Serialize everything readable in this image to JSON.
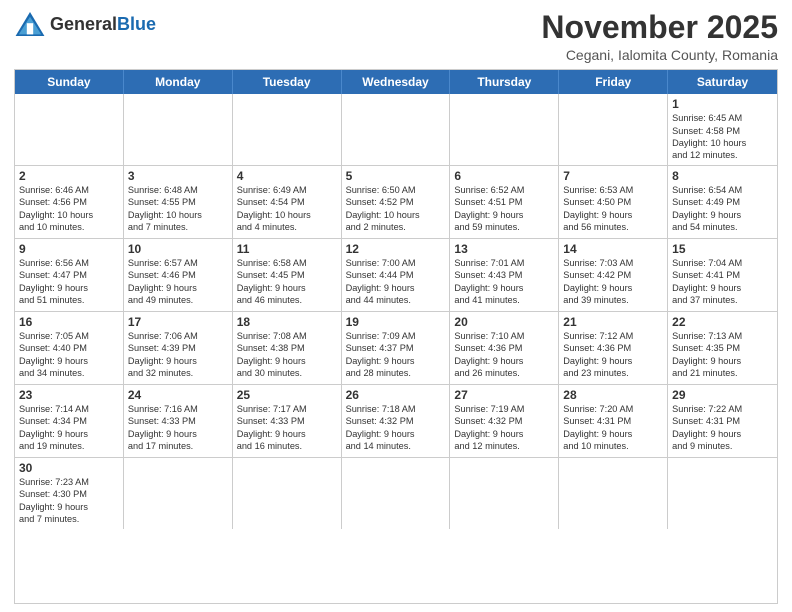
{
  "logo": {
    "text_general": "General",
    "text_blue": "Blue"
  },
  "header": {
    "title": "November 2025",
    "subtitle": "Cegani, Ialomita County, Romania"
  },
  "day_headers": [
    "Sunday",
    "Monday",
    "Tuesday",
    "Wednesday",
    "Thursday",
    "Friday",
    "Saturday"
  ],
  "weeks": [
    [
      {
        "date": "",
        "info": ""
      },
      {
        "date": "",
        "info": ""
      },
      {
        "date": "",
        "info": ""
      },
      {
        "date": "",
        "info": ""
      },
      {
        "date": "",
        "info": ""
      },
      {
        "date": "",
        "info": ""
      },
      {
        "date": "1",
        "info": "Sunrise: 6:45 AM\nSunset: 4:58 PM\nDaylight: 10 hours\nand 12 minutes."
      }
    ],
    [
      {
        "date": "2",
        "info": "Sunrise: 6:46 AM\nSunset: 4:56 PM\nDaylight: 10 hours\nand 10 minutes."
      },
      {
        "date": "3",
        "info": "Sunrise: 6:48 AM\nSunset: 4:55 PM\nDaylight: 10 hours\nand 7 minutes."
      },
      {
        "date": "4",
        "info": "Sunrise: 6:49 AM\nSunset: 4:54 PM\nDaylight: 10 hours\nand 4 minutes."
      },
      {
        "date": "5",
        "info": "Sunrise: 6:50 AM\nSunset: 4:52 PM\nDaylight: 10 hours\nand 2 minutes."
      },
      {
        "date": "6",
        "info": "Sunrise: 6:52 AM\nSunset: 4:51 PM\nDaylight: 9 hours\nand 59 minutes."
      },
      {
        "date": "7",
        "info": "Sunrise: 6:53 AM\nSunset: 4:50 PM\nDaylight: 9 hours\nand 56 minutes."
      },
      {
        "date": "8",
        "info": "Sunrise: 6:54 AM\nSunset: 4:49 PM\nDaylight: 9 hours\nand 54 minutes."
      }
    ],
    [
      {
        "date": "9",
        "info": "Sunrise: 6:56 AM\nSunset: 4:47 PM\nDaylight: 9 hours\nand 51 minutes."
      },
      {
        "date": "10",
        "info": "Sunrise: 6:57 AM\nSunset: 4:46 PM\nDaylight: 9 hours\nand 49 minutes."
      },
      {
        "date": "11",
        "info": "Sunrise: 6:58 AM\nSunset: 4:45 PM\nDaylight: 9 hours\nand 46 minutes."
      },
      {
        "date": "12",
        "info": "Sunrise: 7:00 AM\nSunset: 4:44 PM\nDaylight: 9 hours\nand 44 minutes."
      },
      {
        "date": "13",
        "info": "Sunrise: 7:01 AM\nSunset: 4:43 PM\nDaylight: 9 hours\nand 41 minutes."
      },
      {
        "date": "14",
        "info": "Sunrise: 7:03 AM\nSunset: 4:42 PM\nDaylight: 9 hours\nand 39 minutes."
      },
      {
        "date": "15",
        "info": "Sunrise: 7:04 AM\nSunset: 4:41 PM\nDaylight: 9 hours\nand 37 minutes."
      }
    ],
    [
      {
        "date": "16",
        "info": "Sunrise: 7:05 AM\nSunset: 4:40 PM\nDaylight: 9 hours\nand 34 minutes."
      },
      {
        "date": "17",
        "info": "Sunrise: 7:06 AM\nSunset: 4:39 PM\nDaylight: 9 hours\nand 32 minutes."
      },
      {
        "date": "18",
        "info": "Sunrise: 7:08 AM\nSunset: 4:38 PM\nDaylight: 9 hours\nand 30 minutes."
      },
      {
        "date": "19",
        "info": "Sunrise: 7:09 AM\nSunset: 4:37 PM\nDaylight: 9 hours\nand 28 minutes."
      },
      {
        "date": "20",
        "info": "Sunrise: 7:10 AM\nSunset: 4:36 PM\nDaylight: 9 hours\nand 26 minutes."
      },
      {
        "date": "21",
        "info": "Sunrise: 7:12 AM\nSunset: 4:36 PM\nDaylight: 9 hours\nand 23 minutes."
      },
      {
        "date": "22",
        "info": "Sunrise: 7:13 AM\nSunset: 4:35 PM\nDaylight: 9 hours\nand 21 minutes."
      }
    ],
    [
      {
        "date": "23",
        "info": "Sunrise: 7:14 AM\nSunset: 4:34 PM\nDaylight: 9 hours\nand 19 minutes."
      },
      {
        "date": "24",
        "info": "Sunrise: 7:16 AM\nSunset: 4:33 PM\nDaylight: 9 hours\nand 17 minutes."
      },
      {
        "date": "25",
        "info": "Sunrise: 7:17 AM\nSunset: 4:33 PM\nDaylight: 9 hours\nand 16 minutes."
      },
      {
        "date": "26",
        "info": "Sunrise: 7:18 AM\nSunset: 4:32 PM\nDaylight: 9 hours\nand 14 minutes."
      },
      {
        "date": "27",
        "info": "Sunrise: 7:19 AM\nSunset: 4:32 PM\nDaylight: 9 hours\nand 12 minutes."
      },
      {
        "date": "28",
        "info": "Sunrise: 7:20 AM\nSunset: 4:31 PM\nDaylight: 9 hours\nand 10 minutes."
      },
      {
        "date": "29",
        "info": "Sunrise: 7:22 AM\nSunset: 4:31 PM\nDaylight: 9 hours\nand 9 minutes."
      }
    ],
    [
      {
        "date": "30",
        "info": "Sunrise: 7:23 AM\nSunset: 4:30 PM\nDaylight: 9 hours\nand 7 minutes."
      },
      {
        "date": "",
        "info": ""
      },
      {
        "date": "",
        "info": ""
      },
      {
        "date": "",
        "info": ""
      },
      {
        "date": "",
        "info": ""
      },
      {
        "date": "",
        "info": ""
      },
      {
        "date": "",
        "info": ""
      }
    ]
  ]
}
